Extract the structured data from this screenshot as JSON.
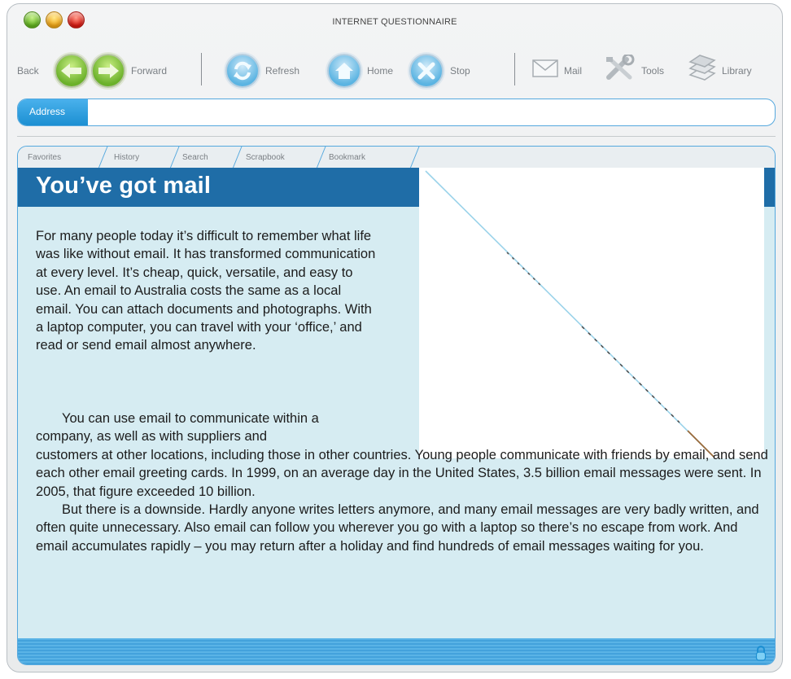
{
  "window": {
    "title": "INTERNET QUESTIONNAIRE",
    "traffic_lights": [
      "green",
      "yellow",
      "red"
    ]
  },
  "toolbar": {
    "back_label": "Back",
    "forward_label": "Forward",
    "refresh_label": "Refresh",
    "home_label": "Home",
    "stop_label": "Stop",
    "mail_label": "Mail",
    "tools_label": "Tools",
    "library_label": "Library"
  },
  "address": {
    "label": "Address",
    "value": ""
  },
  "tabs": [
    {
      "label": "Favorites"
    },
    {
      "label": "History"
    },
    {
      "label": "Search"
    },
    {
      "label": "Scrapbook"
    },
    {
      "label": "Bookmark"
    }
  ],
  "article": {
    "headline": "You’ve got mail",
    "paragraph1": "For many people today it’s difficult to remember what life was like without email. It has transformed communication at every level. It’s cheap, quick, versatile, and easy to use. An email to Australia costs the same as a local email. You can attach documents and photographs. With a laptop computer, you can travel with your ‘office,’ and read or send email almost anywhere.",
    "paragraph2_start": "You can use email to communicate within a company, as well as with suppliers and",
    "paragraph2_rest": "customers at other locations, including those in other countries. Young people communicate with friends by email, and send each other email greeting cards. In 1999, on an average day in the United States, 3.5 billion email messages were sent. In 2005, that figure exceeded 10 billion.",
    "paragraph3": "But there is a downside. Hardly anyone writes letters anymore, and many email messages are very badly written, and often quite unnecessary. Also email can follow you wherever you go with a laptop so there’s no escape from work. And email accumulates rapidly – you may return after a holiday and find hundreds of email messages waiting for you."
  },
  "colors": {
    "accent_blue": "#55a8de",
    "banner_blue": "#1f6da7",
    "panel_bg": "#d6ecf2",
    "nav_green": "#6bb12a"
  },
  "icons": [
    "back-arrow-icon",
    "forward-arrow-icon",
    "refresh-icon",
    "home-icon",
    "stop-icon",
    "mail-icon",
    "tools-icon",
    "library-icon",
    "lock-icon"
  ]
}
